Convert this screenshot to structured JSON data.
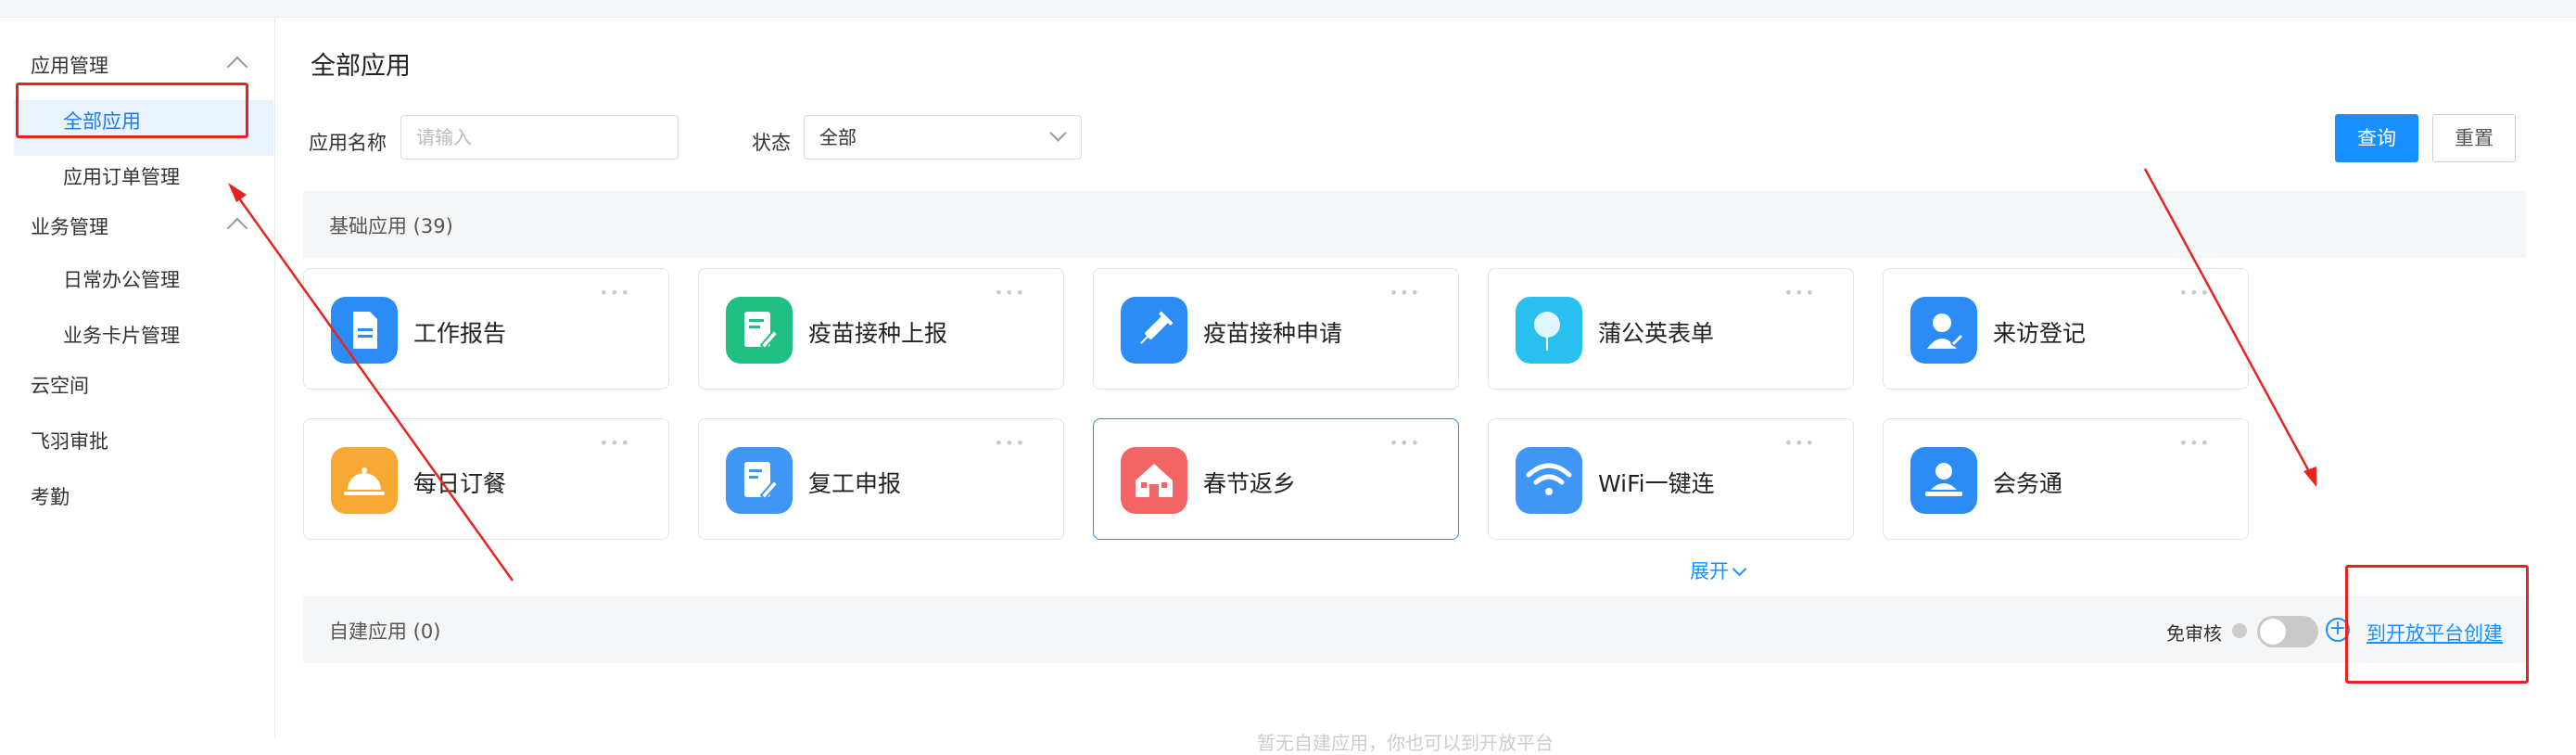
{
  "sidebar": {
    "groups": [
      {
        "label": "应用管理",
        "children": [
          "全部应用",
          "应用订单管理"
        ]
      },
      {
        "label": "业务管理",
        "children": [
          "日常办公管理",
          "业务卡片管理"
        ]
      },
      {
        "label": "云空间"
      },
      {
        "label": "飞羽审批"
      },
      {
        "label": "考勤"
      }
    ],
    "selected": "全部应用"
  },
  "main": {
    "title": "全部应用",
    "filters": {
      "name_label": "应用名称",
      "name_placeholder": "请输入",
      "status_label": "状态",
      "status_value": "全部"
    },
    "buttons": {
      "query": "查询",
      "reset": "重置"
    },
    "basic_section": {
      "title": "基础应用 (39)",
      "apps": [
        {
          "label": "工作报告",
          "icon": "report-doc-icon",
          "color": "#2b8cf5"
        },
        {
          "label": "疫苗接种上报",
          "icon": "vaccine-report-icon",
          "color": "#1fbf84"
        },
        {
          "label": "疫苗接种申请",
          "icon": "syringe-icon",
          "color": "#2b8cf5"
        },
        {
          "label": "蒲公英表单",
          "icon": "dandelion-icon",
          "color": "#29c0f0"
        },
        {
          "label": "来访登记",
          "icon": "visitor-icon",
          "color": "#2b8cf5"
        },
        {
          "label": "每日订餐",
          "icon": "meal-bell-icon",
          "color": "#f7a833"
        },
        {
          "label": "复工申报",
          "icon": "resume-work-icon",
          "color": "#3f96f4"
        },
        {
          "label": "春节返乡",
          "icon": "home-icon",
          "color": "#f46464"
        },
        {
          "label": "WiFi一键连",
          "icon": "wifi-icon",
          "color": "#3f96f4"
        },
        {
          "label": "会务通",
          "icon": "meeting-icon",
          "color": "#2b8cf5"
        }
      ],
      "expand_label": "展开"
    },
    "custom_section": {
      "title": "自建应用 (0)",
      "no_review_label": "免审核",
      "create_link": "到开放平台创建"
    },
    "bottom_hint": "暂无自建应用，你也可以到开放平台"
  },
  "colors": {
    "primary": "#1890ff",
    "annotation": "#e8231f",
    "selected_bg": "#e8f3ff"
  }
}
